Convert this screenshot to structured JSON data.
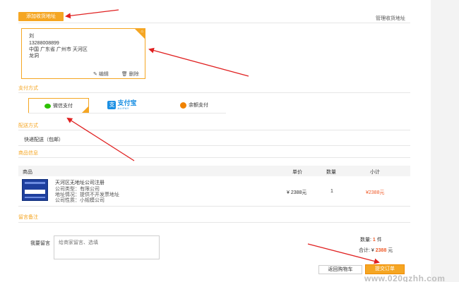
{
  "header": {
    "add_address_label": "添加收货地址",
    "manage_address_label": "管理收货地址"
  },
  "address": {
    "name": "刘",
    "phone": "13288008899",
    "region": "中国 广东省 广州市 天河区",
    "street": "龙洞",
    "edit_label": "编辑",
    "delete_label": "删除"
  },
  "payment": {
    "title": "支付方式",
    "options": [
      {
        "label": "微信支付",
        "selected": true
      },
      {
        "label": "支付宝",
        "sublabel": "ALIPAY",
        "selected": false
      },
      {
        "label": "余额支付",
        "selected": false
      }
    ]
  },
  "shipping": {
    "title": "配送方式",
    "method": "快递配送（包邮）"
  },
  "goods": {
    "title": "商品信息",
    "columns": {
      "product": "商品",
      "price": "单价",
      "qty": "数量",
      "subtotal": "小计"
    },
    "items": [
      {
        "name": "天河区无地址公司注册",
        "type": "公司类型：有限公司",
        "addr_note": "地址情况：提供不开发票地址",
        "nature": "公司性质：小规模公司",
        "price": "¥ 2388元",
        "qty": "1",
        "subtotal": "¥2388元"
      }
    ]
  },
  "remarks": {
    "title": "留言备注",
    "label": "我要留言",
    "placeholder": "给商家留言、选填"
  },
  "summary": {
    "count_label": "数量:",
    "count_value": "1",
    "count_unit": "件",
    "total_label": "合计:",
    "total_currency": "¥",
    "total_value": "2388",
    "total_unit": "元"
  },
  "actions": {
    "back_label": "返回购物车",
    "submit_label": "提交订单"
  },
  "watermark": "www.020gzhh.com",
  "colors": {
    "accent": "#f5a623",
    "price": "#f05a28",
    "annotation": "#e02020"
  }
}
